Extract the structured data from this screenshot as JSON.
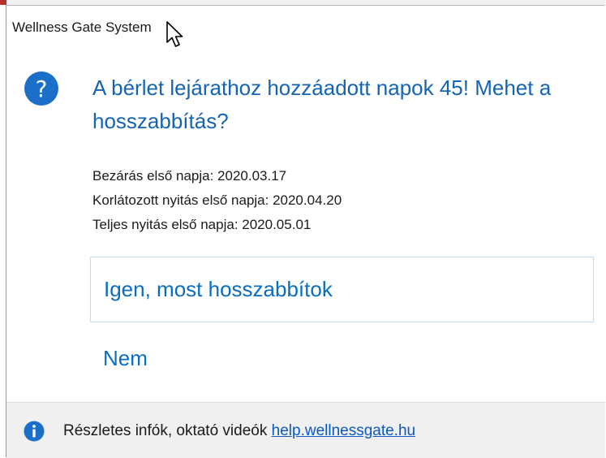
{
  "window": {
    "title": "Wellness Gate System"
  },
  "dialog": {
    "icon": "question-icon",
    "main_instruction": "A bérlet lejárathoz hozzáadott napok 45! Mehet a hosszabbítás?",
    "details": [
      "Bezárás első napja: 2020.03.17",
      "Korlátozott nyitás első napja: 2020.04.20",
      "Teljes nyitás első napja: 2020.05.01"
    ],
    "commands": {
      "yes": "Igen, most hosszabbítok",
      "no": "Nem"
    }
  },
  "footer": {
    "icon": "info-icon",
    "text": "Részletes infók, oktató videók ",
    "link": "help.wellnessgate.hu"
  },
  "colors": {
    "accent_text": "#1464b4",
    "command_link": "#0a6dc0",
    "icon_blue": "#1c6fc9",
    "footer_bg": "#f0f0f0"
  }
}
